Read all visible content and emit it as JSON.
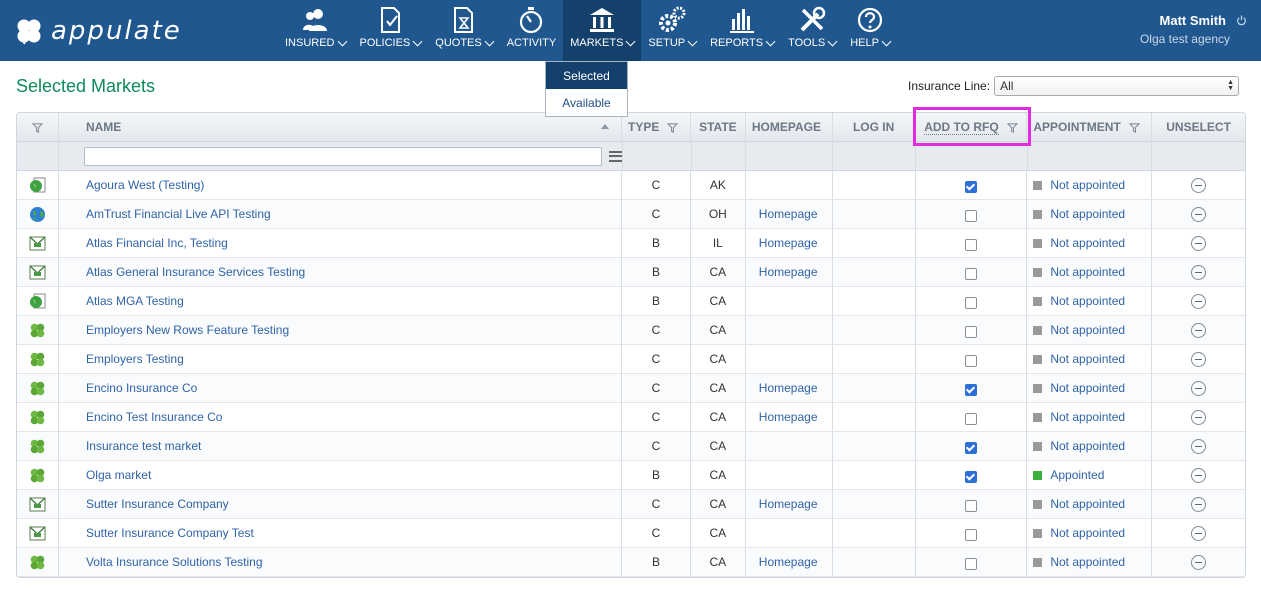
{
  "app": {
    "logo_text": "appulate"
  },
  "nav": [
    {
      "label": "INSURED",
      "icon": "insured-icon"
    },
    {
      "label": "POLICIES",
      "icon": "policies-icon"
    },
    {
      "label": "QUOTES",
      "icon": "quotes-icon"
    },
    {
      "label": "ACTIVITY",
      "icon": "activity-icon"
    },
    {
      "label": "MARKETS",
      "icon": "markets-icon",
      "active": true
    },
    {
      "label": "SETUP",
      "icon": "setup-icon"
    },
    {
      "label": "REPORTS",
      "icon": "reports-icon"
    },
    {
      "label": "TOOLS",
      "icon": "tools-icon"
    },
    {
      "label": "HELP",
      "icon": "help-icon"
    }
  ],
  "user": {
    "name": "Matt Smith",
    "agency": "Olga test agency"
  },
  "markets_menu": {
    "selected": "Selected",
    "available": "Available"
  },
  "page": {
    "title": "Selected Markets"
  },
  "insurance_line": {
    "label": "Insurance Line:",
    "value": "All"
  },
  "columns": {
    "name": "NAME",
    "type": "TYPE",
    "state": "STATE",
    "homepage": "HOMEPAGE",
    "login": "LOG IN",
    "add_rfq": "ADD TO RFQ",
    "appointment": "APPOINTMENT",
    "unselect": "UNSELECT"
  },
  "filter": {
    "name_value": ""
  },
  "rows": [
    {
      "icon": "globe-doc-icon",
      "name": "Agoura West (Testing)",
      "type": "C",
      "state": "AK",
      "homepage": "",
      "rfq": true,
      "appointment": "Not appointed",
      "appointed": false
    },
    {
      "icon": "globe-icon",
      "name": "AmTrust Financial Live API Testing",
      "type": "C",
      "state": "OH",
      "homepage": "Homepage",
      "rfq": false,
      "appointment": "Not appointed",
      "appointed": false
    },
    {
      "icon": "envelope-icon",
      "name": "Atlas Financial Inc, Testing",
      "type": "B",
      "state": "IL",
      "homepage": "Homepage",
      "rfq": false,
      "appointment": "Not appointed",
      "appointed": false
    },
    {
      "icon": "envelope-icon",
      "name": "Atlas General Insurance Services Testing",
      "type": "B",
      "state": "CA",
      "homepage": "Homepage",
      "rfq": false,
      "appointment": "Not appointed",
      "appointed": false
    },
    {
      "icon": "globe-doc-icon",
      "name": "Atlas MGA Testing",
      "type": "B",
      "state": "CA",
      "homepage": "",
      "rfq": false,
      "appointment": "Not appointed",
      "appointed": false
    },
    {
      "icon": "clover-icon",
      "name": "Employers New Rows Feature Testing",
      "type": "C",
      "state": "CA",
      "homepage": "",
      "rfq": false,
      "appointment": "Not appointed",
      "appointed": false
    },
    {
      "icon": "clover-icon",
      "name": "Employers Testing",
      "type": "C",
      "state": "CA",
      "homepage": "",
      "rfq": false,
      "appointment": "Not appointed",
      "appointed": false
    },
    {
      "icon": "clover-icon",
      "name": "Encino Insurance Co",
      "type": "C",
      "state": "CA",
      "homepage": "Homepage",
      "rfq": true,
      "appointment": "Not appointed",
      "appointed": false
    },
    {
      "icon": "clover-icon",
      "name": "Encino Test Insurance Co",
      "type": "C",
      "state": "CA",
      "homepage": "Homepage",
      "rfq": false,
      "appointment": "Not appointed",
      "appointed": false
    },
    {
      "icon": "clover-icon",
      "name": "Insurance test market",
      "type": "C",
      "state": "CA",
      "homepage": "",
      "rfq": true,
      "appointment": "Not appointed",
      "appointed": false
    },
    {
      "icon": "clover-icon",
      "name": "Olga market",
      "type": "B",
      "state": "CA",
      "homepage": "",
      "rfq": true,
      "appointment": "Appointed",
      "appointed": true
    },
    {
      "icon": "envelope-icon",
      "name": "Sutter Insurance Company",
      "type": "C",
      "state": "CA",
      "homepage": "Homepage",
      "rfq": false,
      "appointment": "Not appointed",
      "appointed": false
    },
    {
      "icon": "envelope-icon",
      "name": "Sutter Insurance Company Test",
      "type": "C",
      "state": "CA",
      "homepage": "",
      "rfq": false,
      "appointment": "Not appointed",
      "appointed": false
    },
    {
      "icon": "clover-icon",
      "name": "Volta Insurance Solutions Testing",
      "type": "B",
      "state": "CA",
      "homepage": "Homepage",
      "rfq": false,
      "appointment": "Not appointed",
      "appointed": false
    }
  ]
}
